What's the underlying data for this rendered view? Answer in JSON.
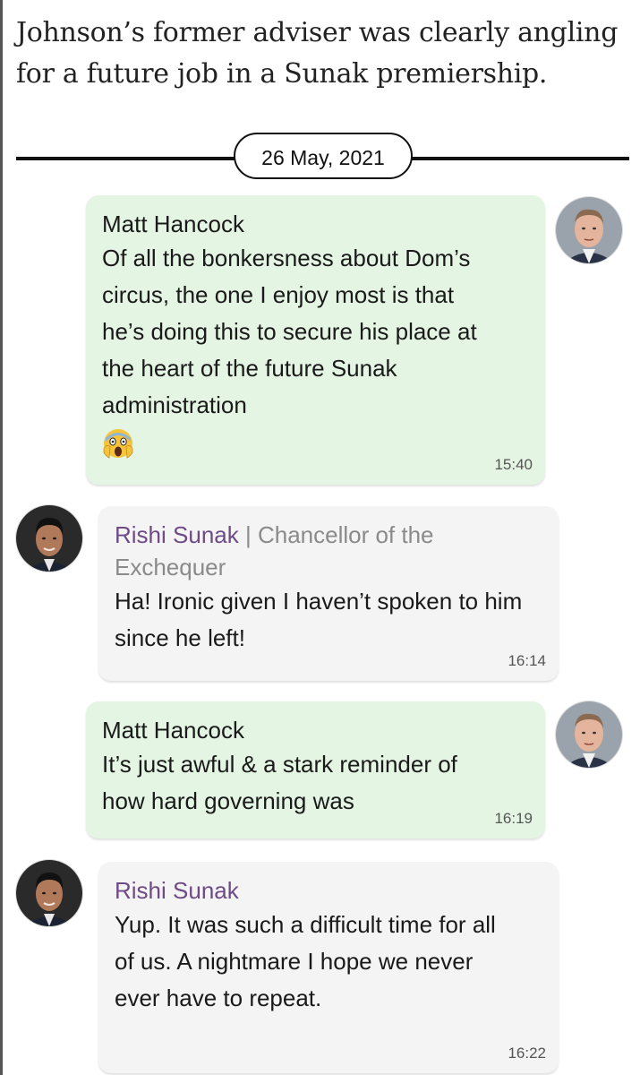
{
  "intro_text": "Johnson’s former adviser was clearly angling for a future job in a Sunak premiership.",
  "date_label": "26 May, 2021",
  "messages": [
    {
      "sender": "Matt Hancock",
      "text": "Of all the bonkersness about Dom’s circus, the one I enjoy most is that he’s doing this to secure his place at the heart of the future Sunak administration",
      "emoji": "screaming-face-emoji",
      "time": "15:40"
    },
    {
      "sender": "Rishi Sunak",
      "role": "Chancellor of the Exchequer",
      "text": "Ha! Ironic given I haven’t spoken to him since he left!",
      "time": "16:14"
    },
    {
      "sender": "Matt Hancock",
      "text": "It’s just awful & a stark reminder of how hard governing was",
      "time": "16:19"
    },
    {
      "sender": "Rishi Sunak",
      "text": "Yup. It was such a difficult time for all of us. A nightmare I hope we never ever have to repeat.",
      "time": "16:22"
    }
  ],
  "colors": {
    "hancock_bubble": "#e4f5e4",
    "sunak_bubble": "#f4f4f4",
    "sunak_name": "#6e4a86",
    "role_text": "#8a8a8a"
  }
}
